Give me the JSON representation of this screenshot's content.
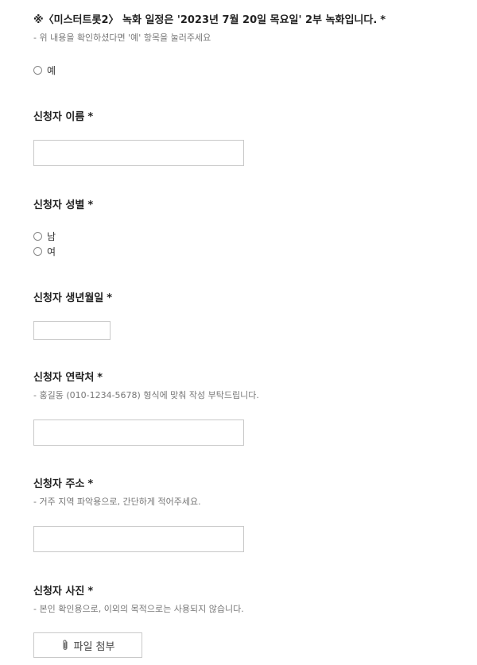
{
  "required_mark": "*",
  "q1": {
    "title": "※〈미스터트롯2〉 녹화 일정은 '2023년 7월 20일 목요일' 2부 녹화입니다.",
    "desc": "- 위 내용을 확인하셨다면 '예' 항목을 눌러주세요",
    "options": [
      "예"
    ]
  },
  "q2": {
    "title": "신청자 이름"
  },
  "q3": {
    "title": "신청자 성별",
    "options": [
      "남",
      "여"
    ]
  },
  "q4": {
    "title": "신청자 생년월일"
  },
  "q5": {
    "title": "신청자 연락처",
    "desc": "- 홍길동 (010-1234-5678) 형식에 맞춰 작성 부탁드립니다."
  },
  "q6": {
    "title": "신청자 주소",
    "desc": "- 거주 지역 파악용으로, 간단하게 적어주세요."
  },
  "q7": {
    "title": "신청자 사진",
    "desc": "- 본인 확인용으로, 이외의 목적으로는 사용되지 않습니다.",
    "button_label": "파일 첨부",
    "button_icon": "paperclip-icon"
  }
}
